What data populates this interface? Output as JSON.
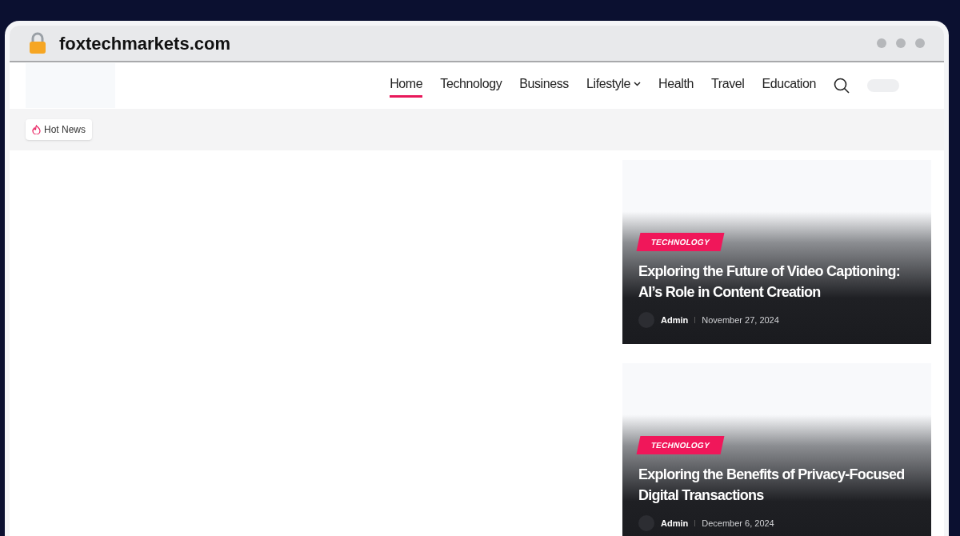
{
  "address_bar": {
    "url": "foxtechmarkets.com"
  },
  "nav": {
    "items": [
      {
        "label": "Home",
        "selected": true,
        "dropdown": false
      },
      {
        "label": "Technology",
        "selected": false,
        "dropdown": false
      },
      {
        "label": "Business",
        "selected": false,
        "dropdown": false
      },
      {
        "label": "Lifestyle",
        "selected": false,
        "dropdown": true
      },
      {
        "label": "Health",
        "selected": false,
        "dropdown": false
      },
      {
        "label": "Travel",
        "selected": false,
        "dropdown": false
      },
      {
        "label": "Education",
        "selected": false,
        "dropdown": false
      }
    ]
  },
  "hot_news": {
    "label": "Hot News"
  },
  "posts": [
    {
      "category": "TECHNOLOGY",
      "title": "Exploring the Future of Video Captioning: AI’s Role in Content Creation",
      "author": "Admin",
      "date": "November 27, 2024"
    },
    {
      "category": "TECHNOLOGY",
      "title": "Exploring the Benefits of Privacy-Focused Digital Transactions",
      "author": "Admin",
      "date": "December 6, 2024"
    }
  ]
}
